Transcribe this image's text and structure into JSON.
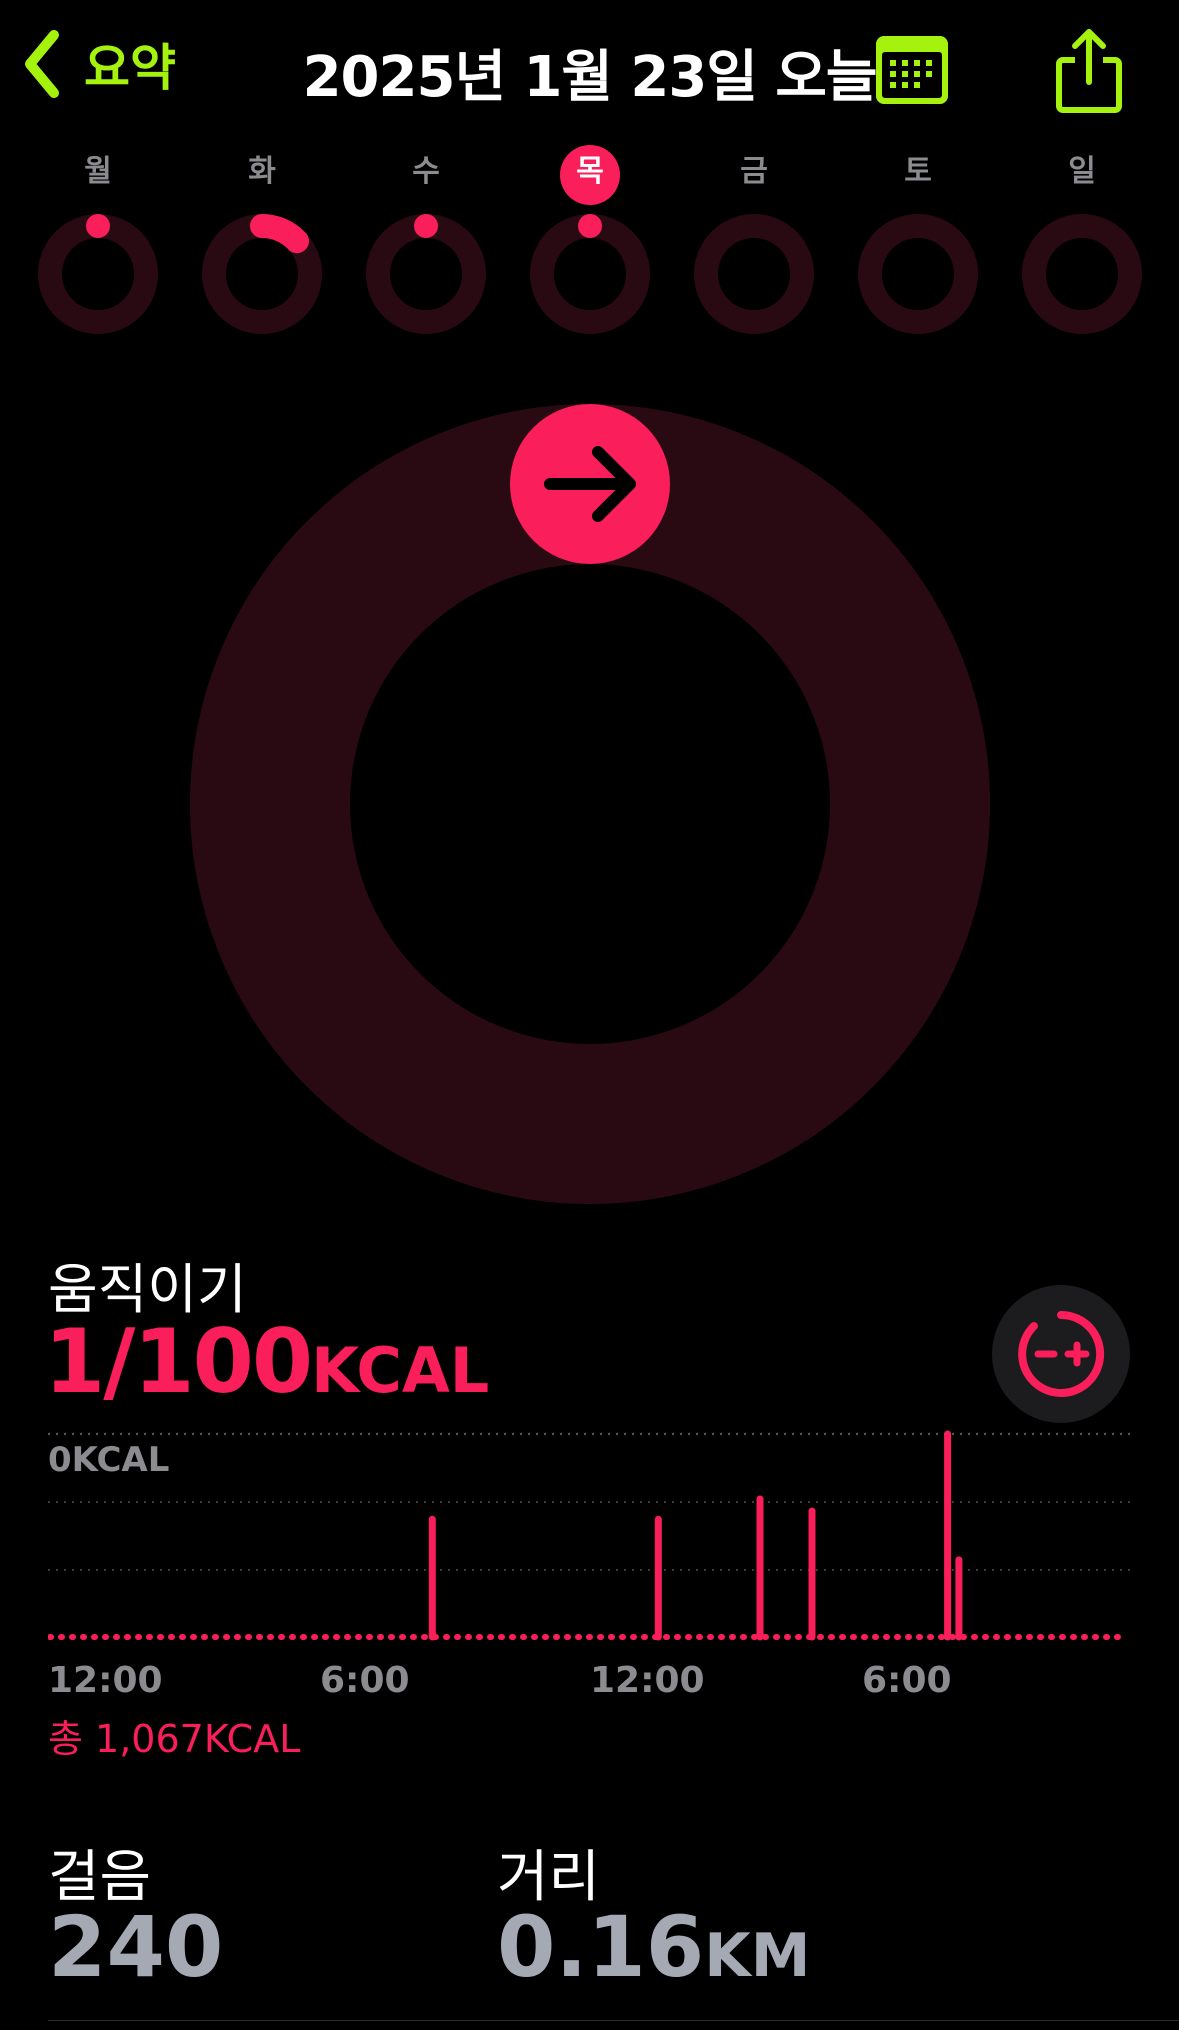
{
  "header": {
    "back_label": "요약",
    "title": "2025년 1월 23일 오늘",
    "accent_color": "#a6f20f",
    "icons": [
      "chevron-left-icon",
      "calendar-icon",
      "share-icon"
    ]
  },
  "week": {
    "days": [
      {
        "label": "월",
        "move_fraction": 0.01,
        "today": false
      },
      {
        "label": "화",
        "move_fraction": 0.13,
        "today": false
      },
      {
        "label": "수",
        "move_fraction": 0.01,
        "today": false
      },
      {
        "label": "목",
        "move_fraction": 0.01,
        "today": true
      },
      {
        "label": "금",
        "move_fraction": 0.0,
        "today": false
      },
      {
        "label": "토",
        "move_fraction": 0.0,
        "today": false
      },
      {
        "label": "일",
        "move_fraction": 0.0,
        "today": false
      }
    ],
    "ring_color": "#fa1e5a",
    "ring_track_color": "#2a0a12"
  },
  "main_ring": {
    "move_fraction": 0.01,
    "icon": "arrow-right-icon"
  },
  "move": {
    "title": "움직이기",
    "value": "1/100",
    "unit": "KCAL",
    "goal_button_icon": "goal-adjust-icon"
  },
  "chart_data": {
    "type": "bar",
    "top_label": "0KCAL",
    "x_tick_labels": [
      "12:00",
      "6:00",
      "12:00",
      "6:00"
    ],
    "hours": [
      8.5,
      13.5,
      15.75,
      16.9,
      19.9,
      20.15
    ],
    "values": [
      0.58,
      0.58,
      0.68,
      0.62,
      1.0,
      0.38
    ],
    "xlim": [
      0,
      24
    ],
    "baseline_dotted": true
  },
  "total_label": "총 1,067KCAL",
  "steps": {
    "title": "걸음",
    "value": "240"
  },
  "distance": {
    "title": "거리",
    "value": "0.16",
    "unit": "KM"
  }
}
